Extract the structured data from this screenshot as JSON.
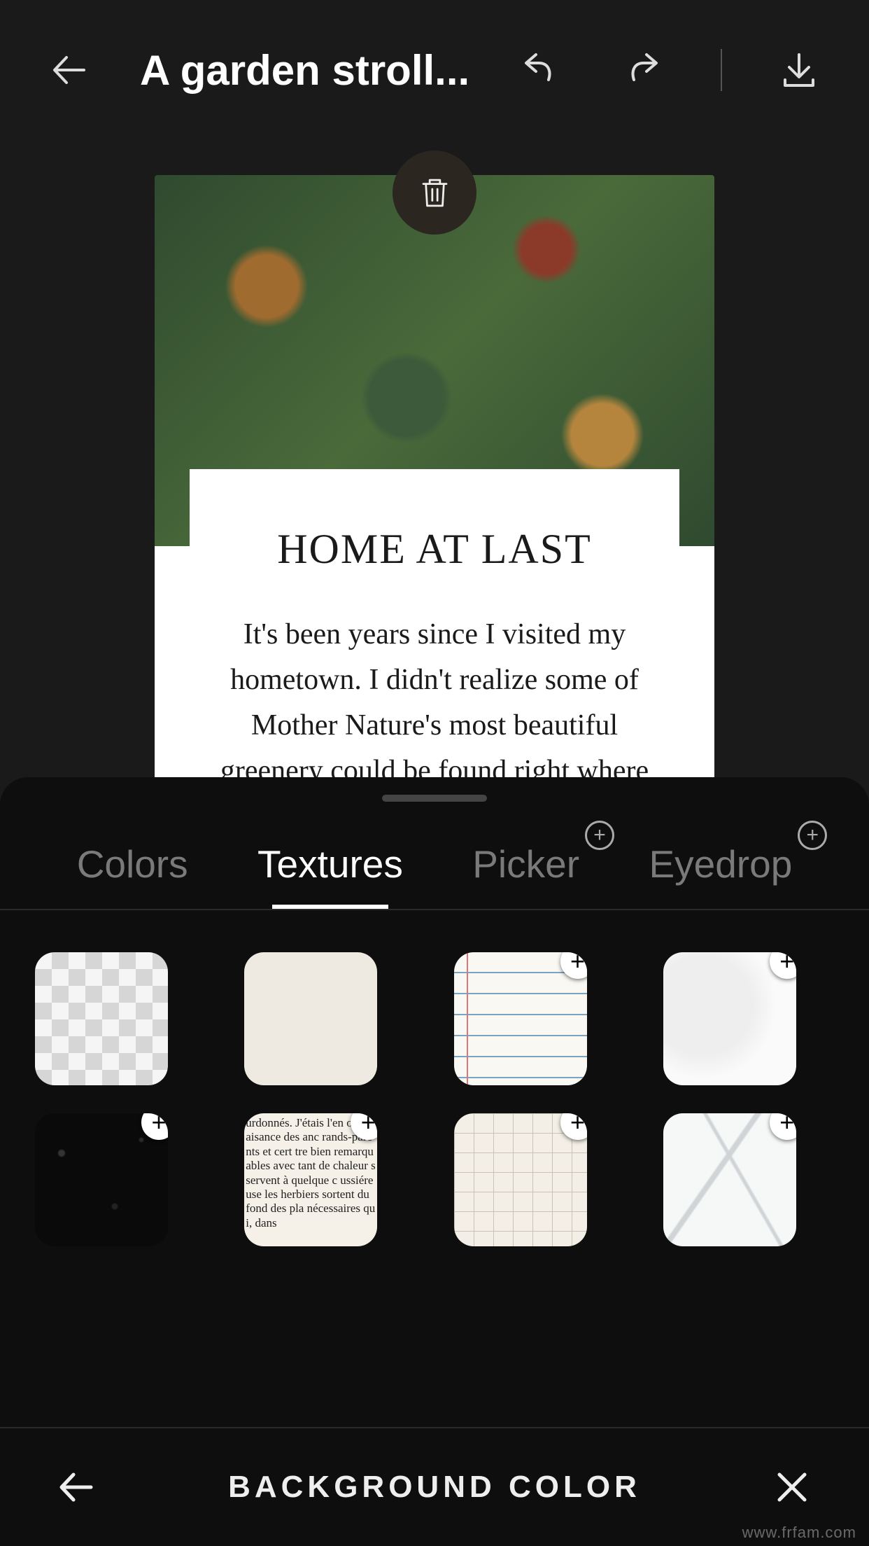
{
  "header": {
    "title": "A garden stroll..."
  },
  "card": {
    "title": "HOME AT LAST",
    "body": "It's been years since I visited my hometown. I didn't realize some of Mother Nature's most beautiful greenery could be found right where I was born and raised."
  },
  "sheet": {
    "tabs": [
      {
        "label": "Colors",
        "active": false,
        "premium": false
      },
      {
        "label": "Textures",
        "active": true,
        "premium": false
      },
      {
        "label": "Picker",
        "active": false,
        "premium": true
      },
      {
        "label": "Eyedrop",
        "active": false,
        "premium": true
      }
    ],
    "textures": [
      {
        "name": "transparent",
        "premium": false
      },
      {
        "name": "cream",
        "premium": false
      },
      {
        "name": "lined-paper",
        "premium": true
      },
      {
        "name": "marble-light",
        "premium": true
      },
      {
        "name": "black-grain",
        "premium": true
      },
      {
        "name": "newsprint",
        "premium": true
      },
      {
        "name": "grid-paper",
        "premium": true
      },
      {
        "name": "marble-vein",
        "premium": true
      }
    ],
    "newsprint_sample": "urdonnés. J'étais l'en omplaisance des anc rands-parents et cert tre bien remarquables avec tant de chaleur s servent à quelque c ussiéreuse les herbiers sortent du fond des pla nécessaires qui, dans"
  },
  "bottombar": {
    "label": "BACKGROUND COLOR"
  },
  "watermark": "www.frfam.com"
}
